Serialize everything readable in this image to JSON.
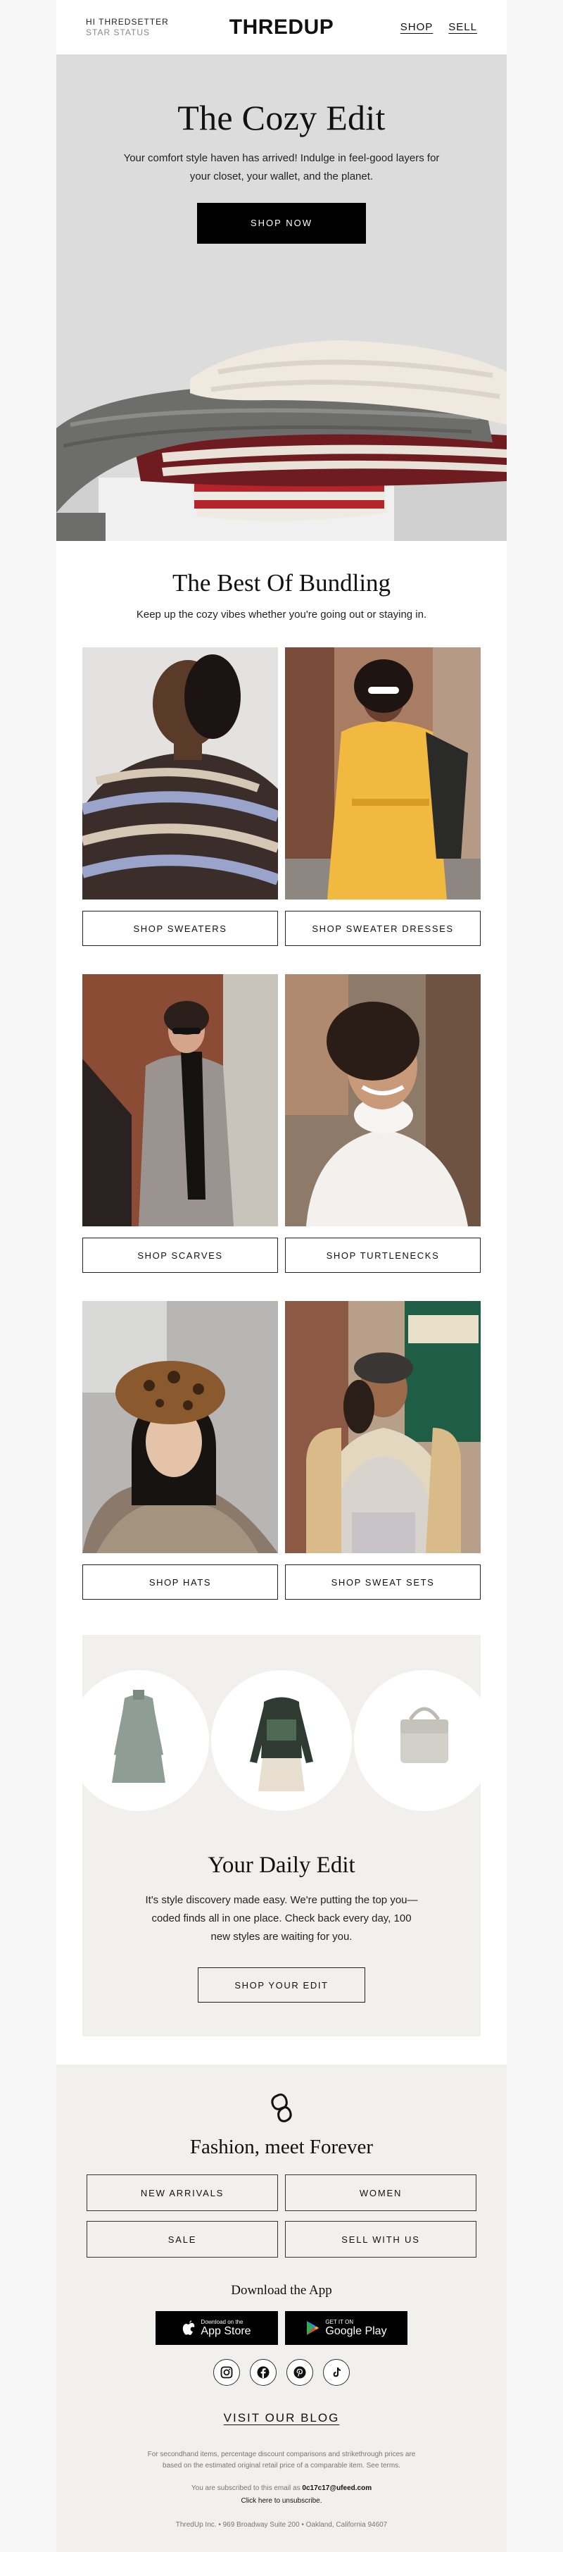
{
  "header": {
    "greeting": "HI THREDSETTER",
    "status": "STAR STATUS",
    "logo": "THREDUP",
    "nav": [
      {
        "label": "SHOP"
      },
      {
        "label": "SELL"
      }
    ]
  },
  "hero": {
    "title": "The Cozy Edit",
    "body": "Your comfort style haven has arrived! Indulge in feel-good layers for your closet, your wallet, and the planet.",
    "cta": "SHOP NOW"
  },
  "bundling": {
    "title": "The Best Of Bundling",
    "subtitle": "Keep up the cozy vibes whether you're going out or staying in.",
    "tiles": [
      {
        "label": "SHOP SWEATERS"
      },
      {
        "label": "SHOP SWEATER DRESSES"
      },
      {
        "label": "SHOP SCARVES"
      },
      {
        "label": "SHOP TURTLENECKS"
      },
      {
        "label": "SHOP HATS"
      },
      {
        "label": "SHOP SWEAT SETS"
      }
    ]
  },
  "daily": {
    "title": "Your Daily Edit",
    "body": "It's style discovery made easy. We're putting the top you—coded finds all in one place. Check back every day, 100 new styles are waiting for you.",
    "cta": "SHOP YOUR EDIT"
  },
  "footer": {
    "tagline": "Fashion, meet Forever",
    "links": [
      {
        "label": "NEW ARRIVALS"
      },
      {
        "label": "WOMEN"
      },
      {
        "label": "SALE"
      },
      {
        "label": "SELL WITH US"
      }
    ],
    "download_title": "Download the App",
    "app_store": {
      "small": "Download on the",
      "big": "App Store"
    },
    "google_play": {
      "small": "GET IT ON",
      "big": "Google Play"
    },
    "socials": [
      {
        "icon": "instagram-icon"
      },
      {
        "icon": "facebook-icon"
      },
      {
        "icon": "pinterest-icon"
      },
      {
        "icon": "tiktok-icon"
      }
    ],
    "blog": "VISIT OUR BLOG",
    "disclaimer": "For secondhand items, percentage discount comparisons and strikethrough prices are based on the estimated original retail price of a comparable item. See terms.",
    "subscribed_prefix": "You are subscribed to this email as",
    "email": "0c17c17@ufeed.com",
    "unsubscribe": "Click here to unsubscribe.",
    "address": "ThredUp Inc. • 969 Broadway Suite 200 • Oakland, California 94607"
  },
  "colors": {
    "hero_bg": "#dcdcdc",
    "panel_bg": "#f1f0ec",
    "accent": "#000000"
  }
}
